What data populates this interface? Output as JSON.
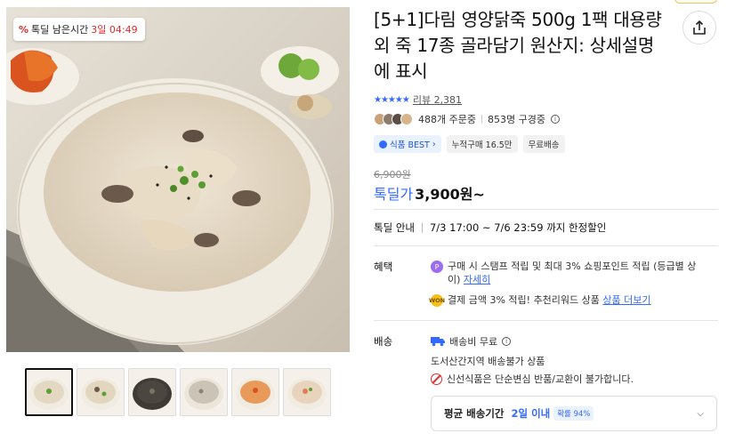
{
  "deal_badge": {
    "icon": "percent-icon",
    "label": "톡딜 남은시간",
    "time": "3일 04:49"
  },
  "product": {
    "title": "[5+1]다림 영양닭죽 500g 1팩 대용량 외 죽 17종 골라담기 원산지: 상세설명에 표시",
    "rating_stars": "★★★★★",
    "review_text": "리뷰 2,381",
    "orders": "488개 주문중",
    "subscribers": "853명 구경중",
    "tags": [
      "식품 BEST",
      "누적구매 16.5만",
      "무료배송"
    ],
    "original_price": "6,900원",
    "deal_label": "톡딜가",
    "price": "3,900원~"
  },
  "deal_info": {
    "label": "톡딜 안내",
    "value": "7/3 17:00 ~ 7/6 23:59 까지 한정할인"
  },
  "benefits": {
    "label": "혜택",
    "item1_text": "구매 시 스탬프 적립 및 최대 3% 쇼핑포인트 적립 (등급별 상이)",
    "item1_link": "자세히",
    "item2_text": "결제 금액 3% 적립! 추천리워드 상품",
    "item2_link": "상품 더보기",
    "item2_coin": "WON"
  },
  "shipping": {
    "label": "배송",
    "fee": "배송비 무료",
    "restriction": "도서산간지역 배송불가 상품",
    "notice": "신선식품은 단순변심 반품/교환이 불가합니다.",
    "avg_label": "평균 배송기간",
    "avg_value": "2일 이내",
    "avg_prob": "확률 94%"
  },
  "colors": {
    "accent": "#346aff",
    "deal_red": "#e4292a",
    "point_purple": "#9b6cf0"
  }
}
